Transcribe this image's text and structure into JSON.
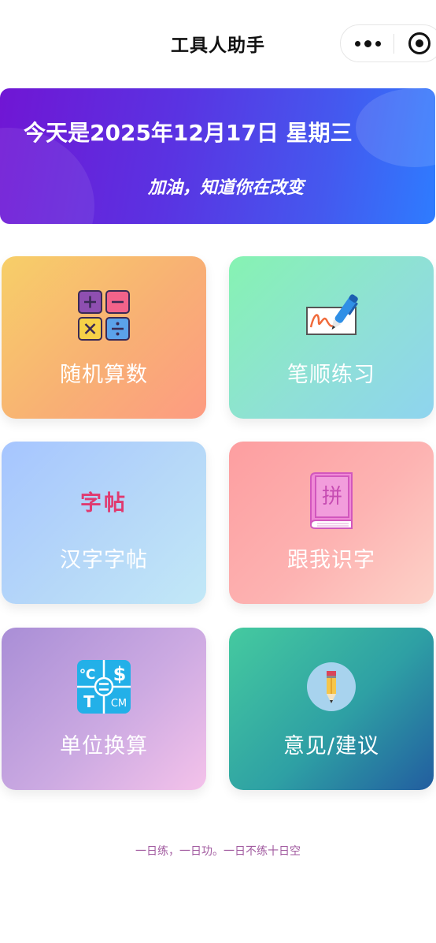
{
  "nav": {
    "title": "工具人助手"
  },
  "banner": {
    "date": "今天是2025年12月17日 星期三",
    "motto": "加油，知道你在改变"
  },
  "cards": [
    {
      "label": "随机算数",
      "icon": "math-operators-icon"
    },
    {
      "label": "笔顺练习",
      "icon": "pen-writing-icon"
    },
    {
      "label": "汉字字帖",
      "icon": "zitie-text-icon",
      "icon_text": "字帖"
    },
    {
      "label": "跟我识字",
      "icon": "pinyin-book-icon",
      "icon_text": "拼"
    },
    {
      "label": "单位换算",
      "icon": "unit-convert-icon"
    },
    {
      "label": "意见/建议",
      "icon": "pencil-icon"
    }
  ],
  "footer": {
    "text": "一日练，一日功。一日不练十日空"
  }
}
